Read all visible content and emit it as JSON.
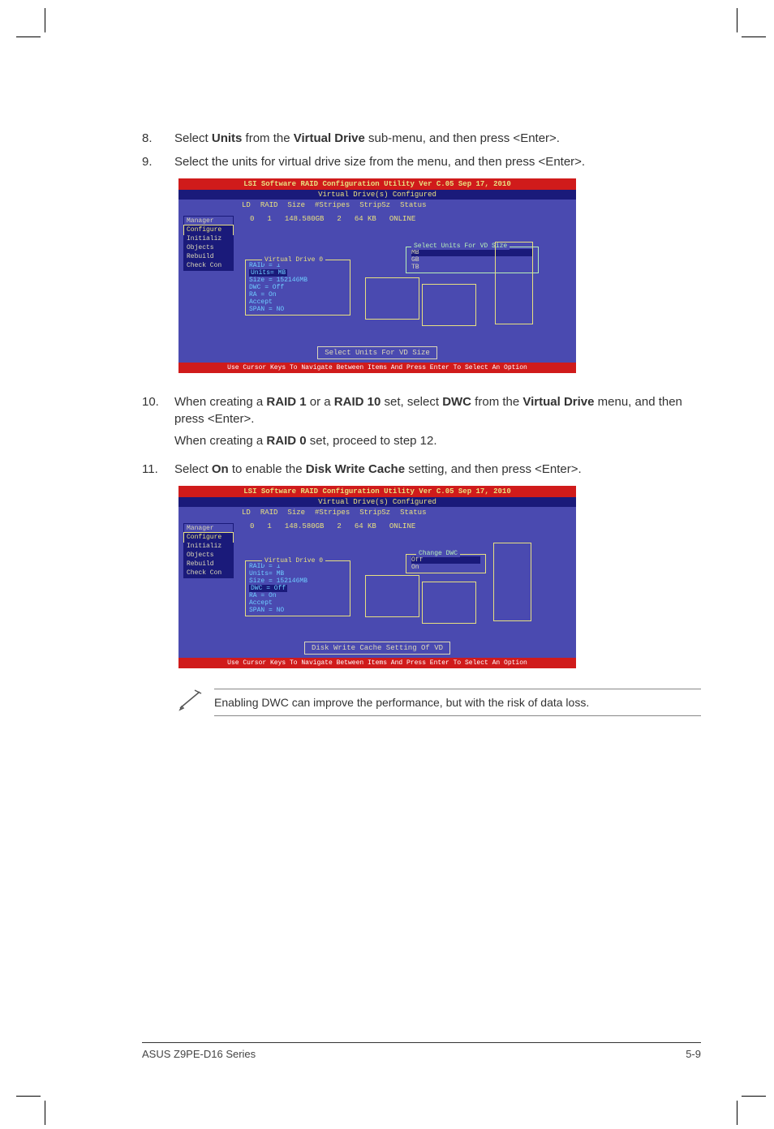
{
  "steps": {
    "s8": {
      "num": "8.",
      "text": "Select <b>Units</b> from the <b>Virtual Drive</b> sub-menu, and then press <Enter>."
    },
    "s9": {
      "num": "9.",
      "text": "Select the units for virtual drive size from the menu, and then press <Enter>."
    },
    "s10": {
      "num": "10.",
      "text1": "When creating a <b>RAID 1</b> or a <b>RAID 10</b> set, select <b>DWC</b> from the <b>Virtual Drive</b> menu, and then press <Enter>.",
      "text2": "When creating a <b>RAID 0</b> set, proceed to step 12."
    },
    "s11": {
      "num": "11.",
      "text": "Select <b>On</b> to enable the <b>Disk Write Cache</b> setting, and then press <Enter>."
    }
  },
  "bios": {
    "title": "LSI Software RAID Configuration Utility Ver C.05 Sep 17, 2010",
    "subtitle": "Virtual Drive(s) Configured",
    "headers": {
      "ld": "LD",
      "raid": "RAID",
      "size": "Size",
      "stripes": "#Stripes",
      "stripsz": "StripSz",
      "status": "Status"
    },
    "row": {
      "ld": "0",
      "raid": "1",
      "size": "148.580GB",
      "stripes": "2",
      "stripsz": "64 KB",
      "status": "ONLINE"
    },
    "menu": [
      "Manager",
      "Configure",
      "Initializ",
      "Objects",
      "Rebuild",
      "Check Con"
    ],
    "vd": {
      "title": "Virtual Drive 0",
      "raid": "RAID = 1",
      "units": "Units= MB",
      "size": "Size = 152146MB",
      "dwc": "DWC  = Off",
      "ra": "RA   = On",
      "accept": "Accept",
      "span": "SPAN = NO"
    },
    "unitsbox": {
      "title": "Select Units For VD Size",
      "opts": [
        "MB",
        "GB",
        "TB"
      ]
    },
    "dwcbox": {
      "title": "Change DWC",
      "opts": [
        "Off",
        "On"
      ]
    },
    "status1": "Select Units For VD Size",
    "status2": "Disk Write Cache Setting Of VD",
    "footer": "Use Cursor Keys To Navigate Between Items And Press Enter To Select An Option"
  },
  "note": "Enabling DWC can improve the performance, but with the risk of data loss.",
  "footer": {
    "left": "ASUS Z9PE-D16 Series",
    "right": "5-9"
  }
}
